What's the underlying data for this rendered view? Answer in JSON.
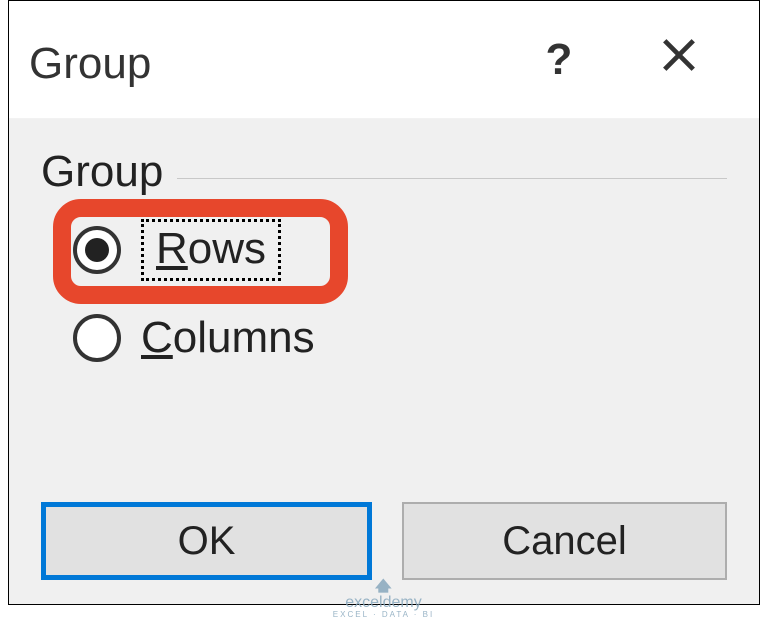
{
  "dialog": {
    "title": "Group",
    "help_tooltip": "?",
    "close_tooltip": "✕"
  },
  "groupbox": {
    "legend": "Group",
    "options": {
      "rows": {
        "label_before": "R",
        "label_after": "ows",
        "selected": true,
        "focused": true
      },
      "columns": {
        "label_before": "C",
        "label_after": "olumns",
        "selected": false,
        "focused": false
      }
    }
  },
  "buttons": {
    "ok": "OK",
    "cancel": "Cancel"
  },
  "watermark": {
    "brand": "exceldemy",
    "tagline": "EXCEL · DATA · BI"
  }
}
